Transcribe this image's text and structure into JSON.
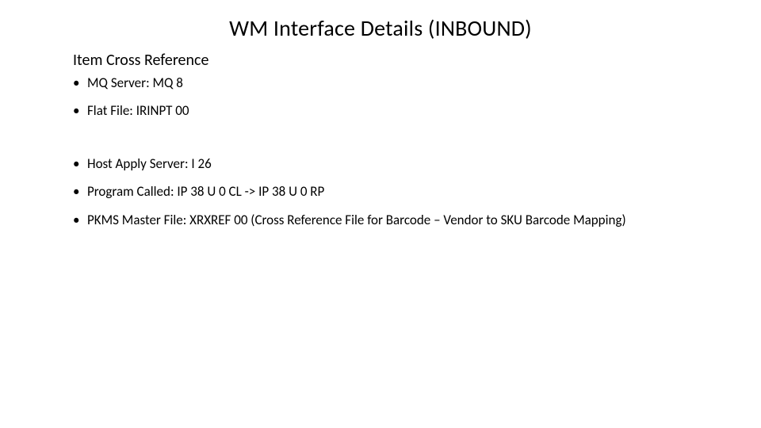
{
  "title": "WM Interface Details (INBOUND)",
  "subtitle": "Item Cross Reference",
  "group1": [
    "MQ Server: MQ 8",
    "Flat File: IRINPT 00"
  ],
  "group2": [
    "Host Apply Server: I 26",
    "Program Called: IP 38 U 0 CL -> IP 38 U 0 RP",
    "PKMS Master File: XRXREF 00 (Cross Reference File for Barcode – Vendor to SKU Barcode Mapping)"
  ]
}
